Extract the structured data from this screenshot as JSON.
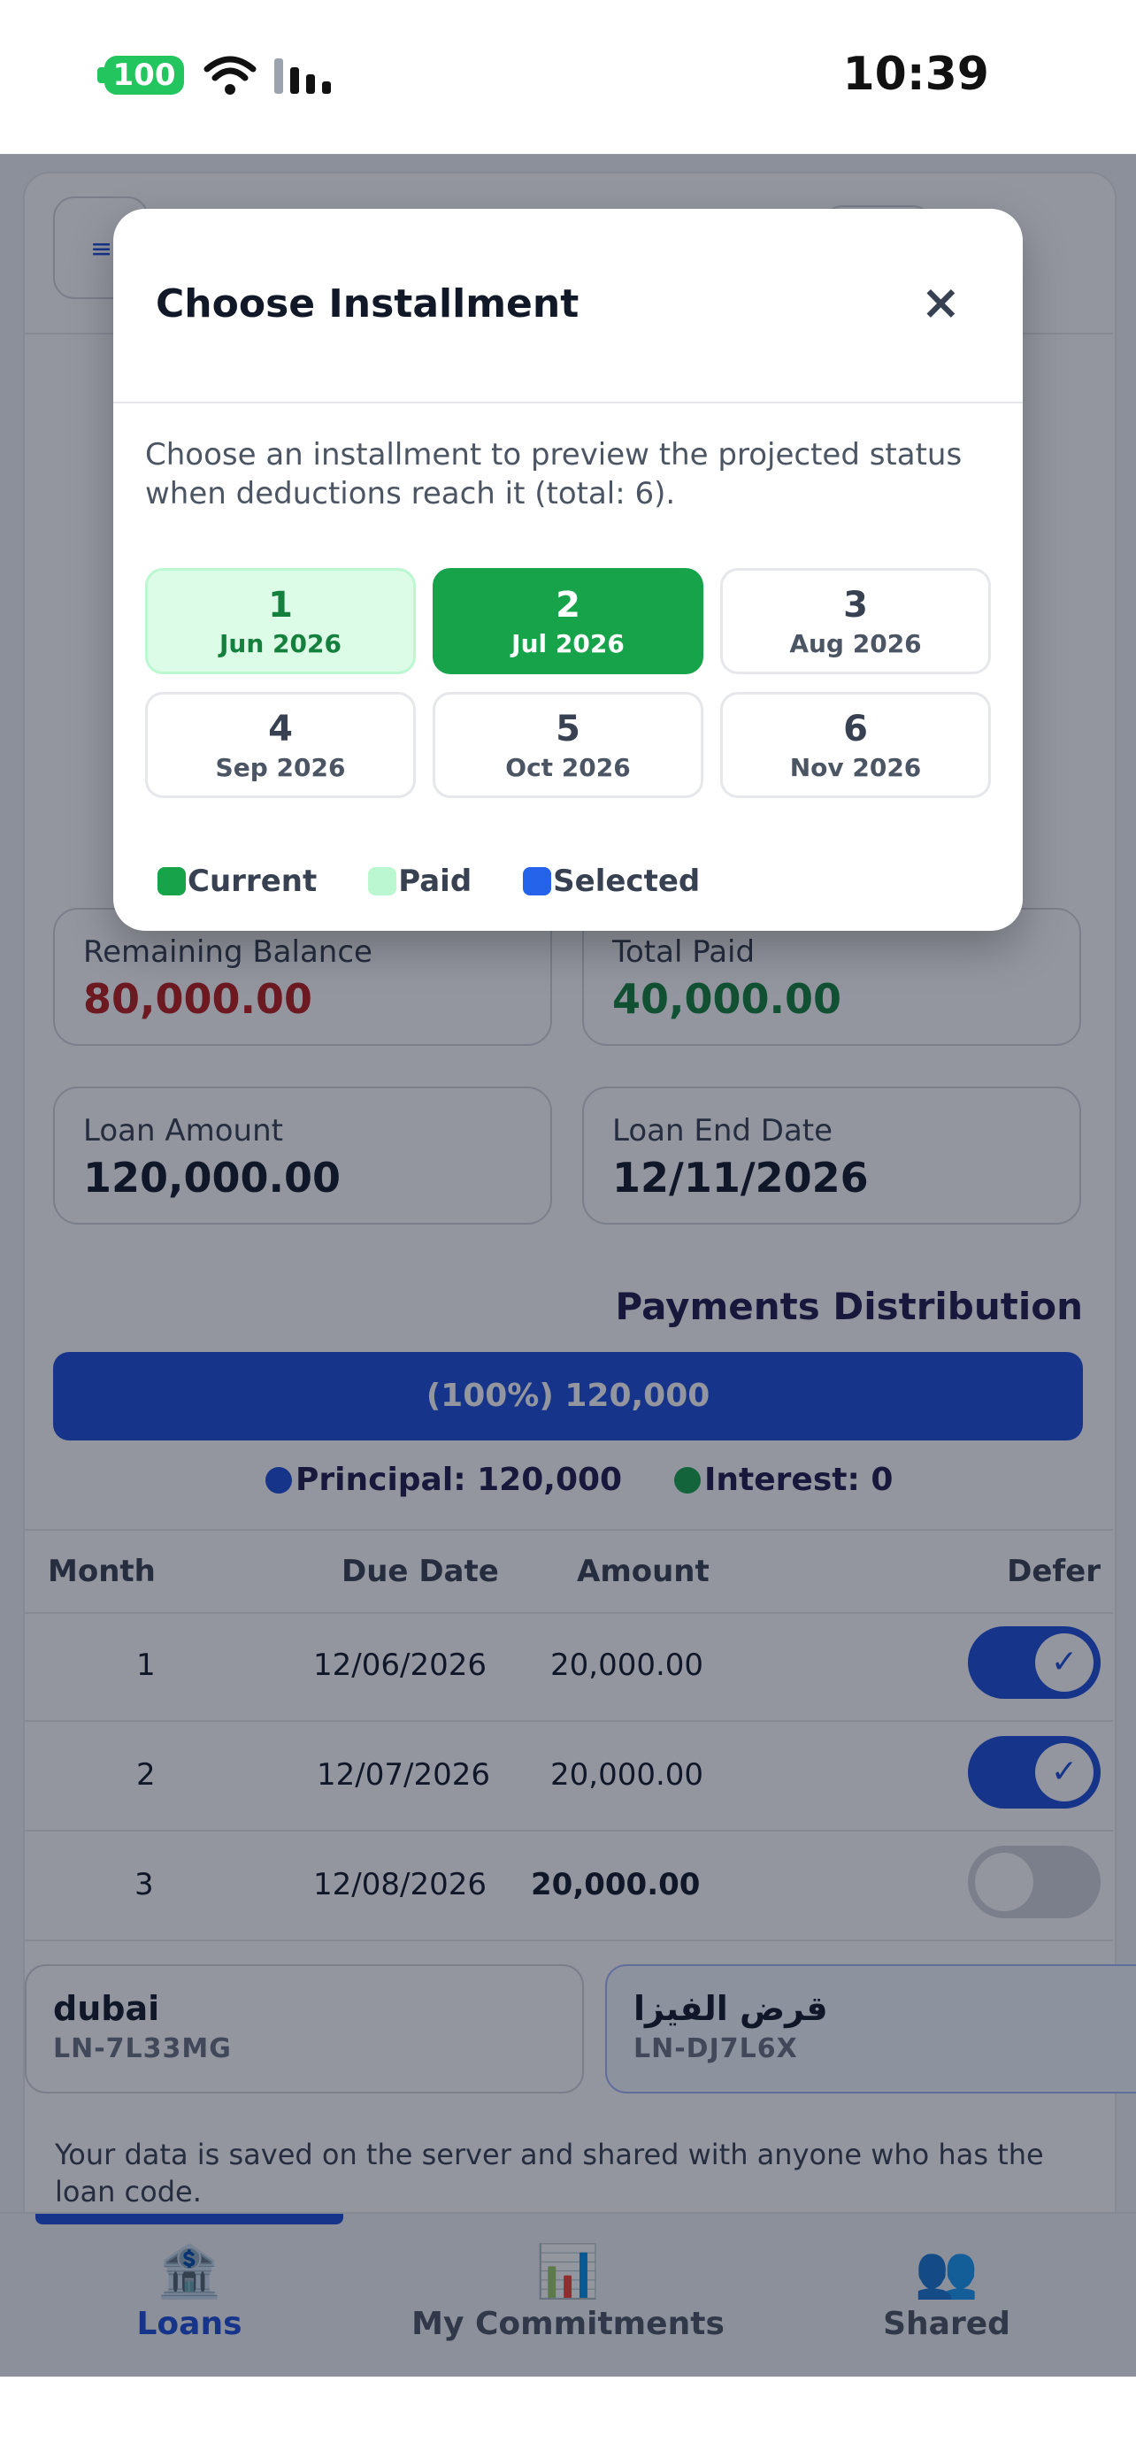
{
  "status_bar": {
    "battery": "100",
    "time": "10:39"
  },
  "app": {
    "menu_icon": "≡",
    "stats": [
      {
        "label": "Remaining Balance",
        "value": "80,000.00",
        "color": "#b91c1c"
      },
      {
        "label": "Total Paid",
        "value": "40,000.00",
        "color": "#15803d"
      },
      {
        "label": "Loan Amount",
        "value": "120,000.00",
        "color": "#111827"
      },
      {
        "label": "Loan End Date",
        "value": "12/11/2026",
        "color": "#111827"
      }
    ],
    "distribution": {
      "title": "Payments Distribution",
      "bar_text": "(100%) 120,000",
      "principal_share": 1.0,
      "principal_label": "Principal: 120,000",
      "interest_label": "Interest: 0"
    },
    "table": {
      "headers": {
        "month": "Month",
        "due_date": "Due Date",
        "amount": "Amount",
        "defer": "Defer"
      },
      "rows": [
        {
          "month": "1",
          "due_date": "12/06/2026",
          "amount": "20,000.00",
          "defer": true
        },
        {
          "month": "2",
          "due_date": "12/07/2026",
          "amount": "20,000.00",
          "defer": true
        },
        {
          "month": "3",
          "due_date": "12/08/2026",
          "amount": "20,000.00",
          "defer": false
        }
      ]
    },
    "loans": [
      {
        "name": "dubai",
        "code": "LN-7L33MG"
      },
      {
        "name": "قرض الفيزا",
        "code": "LN-DJ7L6X"
      }
    ],
    "footnote": "Your data is saved on the server and shared with anyone who has the loan code."
  },
  "bottom_nav": [
    {
      "label": "Loans",
      "icon": "bank-icon",
      "glyph": "🏦"
    },
    {
      "label": "My Commitments",
      "icon": "bar-chart-icon",
      "glyph": "📊"
    },
    {
      "label": "Shared",
      "icon": "people-icon",
      "glyph": "👥"
    }
  ],
  "modal": {
    "title": "Choose Installment",
    "close": "×",
    "description": "Choose an installment to preview the projected status when deductions reach it (total: 6).",
    "installments": [
      {
        "num": "1",
        "date": "Jun 2026",
        "state": "paid"
      },
      {
        "num": "2",
        "date": "Jul 2026",
        "state": "current"
      },
      {
        "num": "3",
        "date": "Aug 2026",
        "state": "default"
      },
      {
        "num": "4",
        "date": "Sep 2026",
        "state": "default"
      },
      {
        "num": "5",
        "date": "Oct 2026",
        "state": "default"
      },
      {
        "num": "6",
        "date": "Nov 2026",
        "state": "default"
      }
    ],
    "legend": [
      {
        "label": "Current",
        "color": "#16a34a"
      },
      {
        "label": "Paid",
        "color": "#bbf7d0"
      },
      {
        "label": "Selected",
        "color": "#2563eb"
      }
    ]
  }
}
